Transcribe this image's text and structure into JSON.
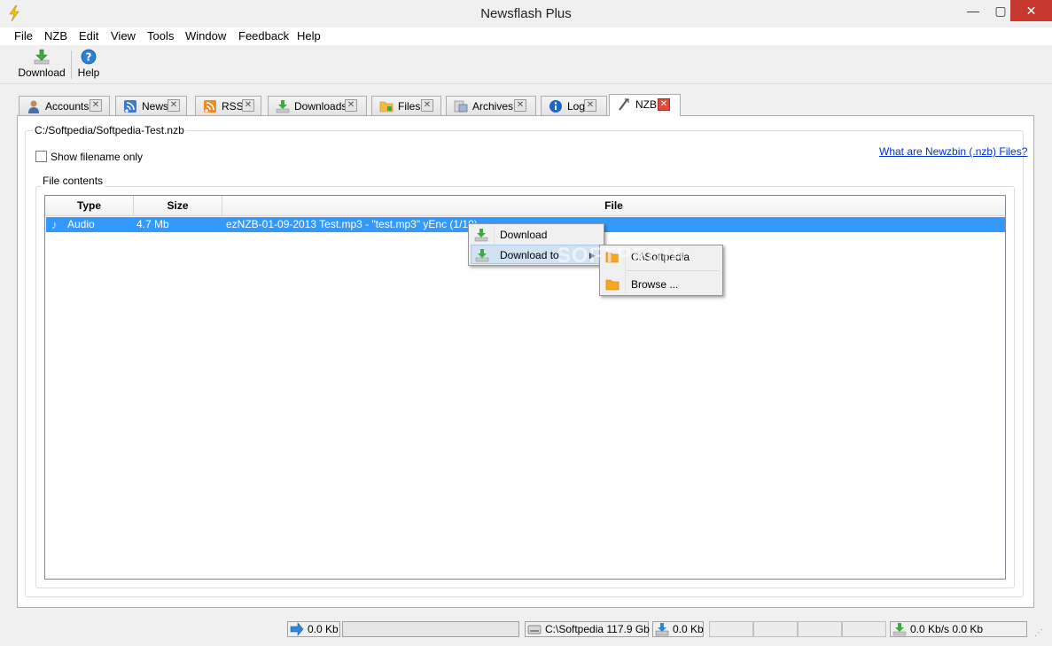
{
  "window": {
    "title": "Newsflash Plus",
    "min_glyph": "—",
    "max_glyph": "▢",
    "close_glyph": "✕"
  },
  "menubar": [
    "File",
    "NZB",
    "Edit",
    "View",
    "Tools",
    "Window",
    "Feedback",
    "Help"
  ],
  "toolbar": {
    "download_label": "Download",
    "help_label": "Help"
  },
  "tabs": [
    {
      "label": "Accounts",
      "icon": "user-icon"
    },
    {
      "label": "News",
      "icon": "news-icon"
    },
    {
      "label": "RSS",
      "icon": "rss-icon"
    },
    {
      "label": "Downloads",
      "icon": "download-icon"
    },
    {
      "label": "Files",
      "icon": "folder-icon"
    },
    {
      "label": "Archives",
      "icon": "archive-icon"
    },
    {
      "label": "Log",
      "icon": "info-icon"
    },
    {
      "label": "NZB",
      "icon": "nzb-icon",
      "active": true
    }
  ],
  "nzb": {
    "path": "C:/Softpedia/Softpedia-Test.nzb",
    "show_filename_label": "Show filename only",
    "show_filename_checked": false,
    "help_link": "What are Newzbin (.nzb) Files?",
    "file_contents_label": "File contents"
  },
  "table": {
    "headers": [
      "Type",
      "Size",
      "File"
    ],
    "rows": [
      {
        "type": "Audio",
        "size": "4.7 Mb",
        "file": "ezNZB-01-09-2013 Test.mp3 - \"test.mp3\" yEnc (1/10)"
      }
    ]
  },
  "context_menu": {
    "items": [
      "Download",
      "Download to"
    ]
  },
  "submenu": {
    "items": [
      "C:\\Softpedia",
      "Browse ..."
    ]
  },
  "watermark": "SOFTPEDIA",
  "statusbar": {
    "upload": "0.0 Kb",
    "disk": "C:\\Softpedia 117.9 Gb",
    "download": "0.0 Kb",
    "speed": "0.0 Kb/s 0.0 Kb"
  },
  "colors": {
    "selection": "#3399ff",
    "close_button": "#c7392f",
    "link": "#0033cc"
  }
}
